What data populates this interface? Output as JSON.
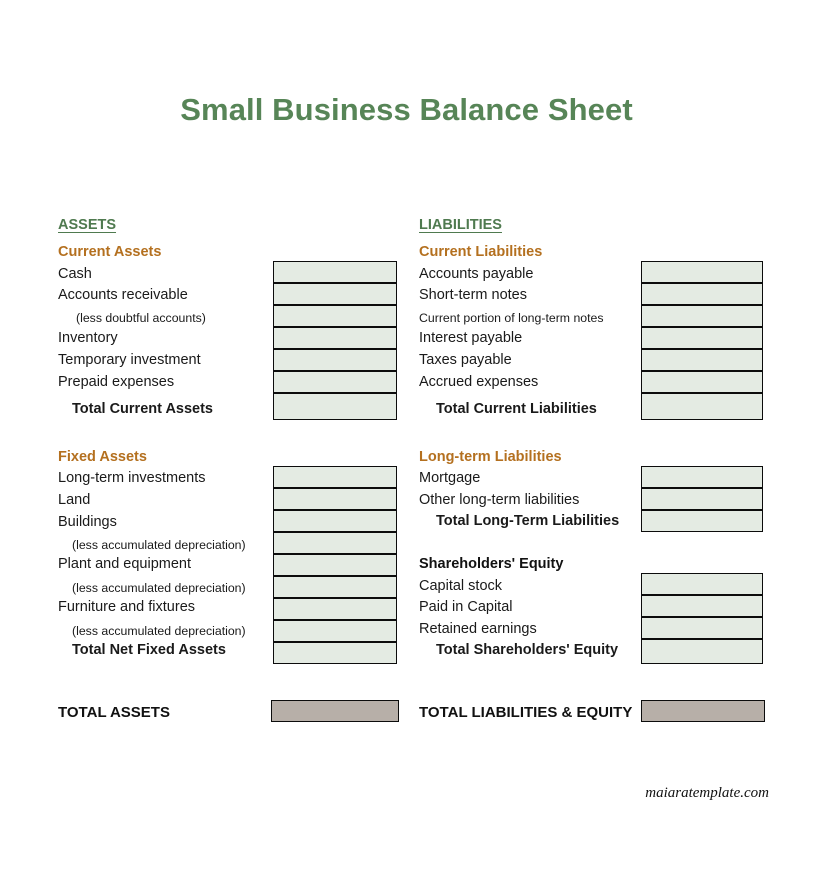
{
  "document": {
    "title": "Small Business Balance Sheet",
    "footer": "maiaratemplate.com"
  },
  "colors": {
    "title_green": "#578557",
    "header_green": "#4f7a4f",
    "subheader_orange": "#b4701f",
    "input_fill": "#e4ebe3",
    "total_fill": "#b7afa8",
    "border": "#0c0c0c",
    "text": "#1a1a1a"
  },
  "assets": {
    "heading": "ASSETS",
    "current": {
      "heading": "Current Assets",
      "items": [
        {
          "label": "Cash",
          "value": "",
          "style": "normal"
        },
        {
          "label": "Accounts receivable",
          "value": "",
          "style": "normal"
        },
        {
          "label": "(less doubtful accounts)",
          "value": "",
          "style": "small-indent"
        },
        {
          "label": "Inventory",
          "value": "",
          "style": "normal"
        },
        {
          "label": "Temporary investment",
          "value": "",
          "style": "normal"
        },
        {
          "label": "Prepaid expenses",
          "value": "",
          "style": "normal"
        },
        {
          "label": "Total Current Assets",
          "value": "",
          "style": "total"
        }
      ]
    },
    "fixed": {
      "heading": "Fixed Assets",
      "items": [
        {
          "label": "Long-term investments",
          "value": "",
          "style": "normal"
        },
        {
          "label": "Land",
          "value": "",
          "style": "normal"
        },
        {
          "label": "Buildings",
          "value": "",
          "style": "normal"
        },
        {
          "label": "(less accumulated  depreciation)",
          "value": "",
          "style": "small-indent"
        },
        {
          "label": "Plant and equipment",
          "value": "",
          "style": "normal"
        },
        {
          "label": "(less accumulated  depreciation)",
          "value": "",
          "style": "small-indent"
        },
        {
          "label": "Furniture and fixtures",
          "value": "",
          "style": "normal"
        },
        {
          "label": "(less accumulated  depreciation)",
          "value": "",
          "style": "small-indent"
        },
        {
          "label": "Total Net Fixed Assets",
          "value": "",
          "style": "total"
        }
      ]
    },
    "grand_total": {
      "label": "TOTAL ASSETS",
      "value": ""
    }
  },
  "liabilities": {
    "heading": "LIABILITIES",
    "current": {
      "heading": "Current Liabilities",
      "items": [
        {
          "label": "Accounts payable",
          "value": "",
          "style": "normal"
        },
        {
          "label": "Short-term notes",
          "value": "",
          "style": "normal"
        },
        {
          "label": "Current portion of long-term  notes",
          "value": "",
          "style": "small"
        },
        {
          "label": "Interest payable",
          "value": "",
          "style": "normal"
        },
        {
          "label": "Taxes payable",
          "value": "",
          "style": "normal"
        },
        {
          "label": "Accrued expenses",
          "value": "",
          "style": "normal"
        },
        {
          "label": "Total Current Liabilities",
          "value": "",
          "style": "total"
        }
      ]
    },
    "longterm": {
      "heading": "Long-term Liabilities",
      "items": [
        {
          "label": "Mortgage",
          "value": "",
          "style": "normal"
        },
        {
          "label": "Other long-term liabilities",
          "value": "",
          "style": "normal"
        },
        {
          "label": "Total Long-Term Liabilities",
          "value": "",
          "style": "total"
        }
      ]
    },
    "equity": {
      "heading": "Shareholders' Equity",
      "items": [
        {
          "label": "Capital stock",
          "value": "",
          "style": "normal"
        },
        {
          "label": "Paid in Capital",
          "value": "",
          "style": "normal"
        },
        {
          "label": "Retained earnings",
          "value": "",
          "style": "normal"
        },
        {
          "label": "Total Shareholders' Equity",
          "value": "",
          "style": "total"
        }
      ]
    },
    "grand_total": {
      "label": "TOTAL LIABILITIES & EQUITY",
      "value": ""
    }
  }
}
